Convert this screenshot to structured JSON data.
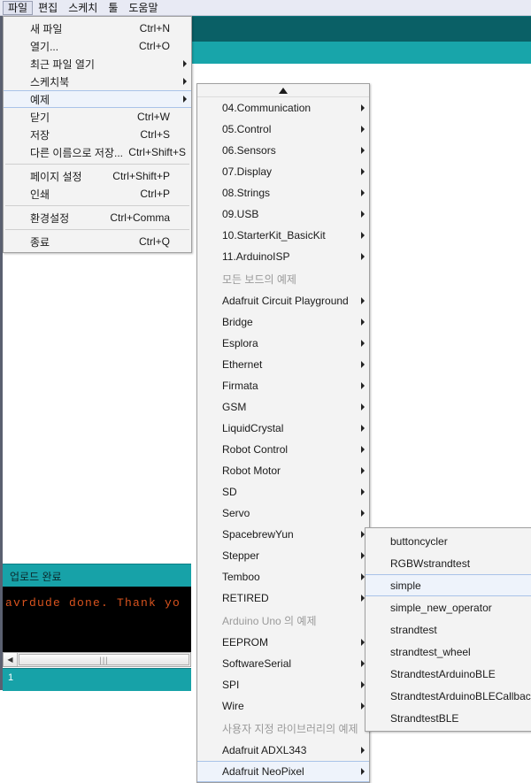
{
  "app": {
    "menubar": [
      {
        "label": "파일",
        "active": true
      },
      {
        "label": "편집",
        "active": false
      },
      {
        "label": "스케치",
        "active": false
      },
      {
        "label": "툴",
        "active": false
      },
      {
        "label": "도움말",
        "active": false
      }
    ]
  },
  "console": {
    "status_label": "업로드 완료",
    "output_line": "avrdude done.  Thank yo",
    "statusbar_text": "1",
    "scrollbar_left_arrow": "◀",
    "scrollbar_grip": "|||"
  },
  "file_menu": {
    "items": [
      {
        "label": "새 파일",
        "accel": "Ctrl+N",
        "submenu": false,
        "selected": false,
        "type": "item"
      },
      {
        "label": "열기...",
        "accel": "Ctrl+O",
        "submenu": false,
        "selected": false,
        "type": "item"
      },
      {
        "label": "최근 파일 열기",
        "accel": "",
        "submenu": true,
        "selected": false,
        "type": "item"
      },
      {
        "label": "스케치북",
        "accel": "",
        "submenu": true,
        "selected": false,
        "type": "item"
      },
      {
        "label": "예제",
        "accel": "",
        "submenu": true,
        "selected": true,
        "type": "item"
      },
      {
        "label": "닫기",
        "accel": "Ctrl+W",
        "submenu": false,
        "selected": false,
        "type": "item"
      },
      {
        "label": "저장",
        "accel": "Ctrl+S",
        "submenu": false,
        "selected": false,
        "type": "item"
      },
      {
        "label": "다른 이름으로 저장...",
        "accel": "Ctrl+Shift+S",
        "submenu": false,
        "selected": false,
        "type": "item",
        "wide": true
      },
      {
        "type": "sep"
      },
      {
        "label": "페이지 설정",
        "accel": "Ctrl+Shift+P",
        "submenu": false,
        "selected": false,
        "type": "item"
      },
      {
        "label": "인쇄",
        "accel": "Ctrl+P",
        "submenu": false,
        "selected": false,
        "type": "item"
      },
      {
        "type": "sep"
      },
      {
        "label": "환경설정",
        "accel": "Ctrl+Comma",
        "submenu": false,
        "selected": false,
        "type": "item"
      },
      {
        "type": "sep"
      },
      {
        "label": "종료",
        "accel": "Ctrl+Q",
        "submenu": false,
        "selected": false,
        "type": "item"
      }
    ]
  },
  "examples_menu": {
    "scroll_up_icon": "scroll-up-triangle",
    "items": [
      {
        "label": "04.Communication",
        "submenu": true,
        "type": "item"
      },
      {
        "label": "05.Control",
        "submenu": true,
        "type": "item"
      },
      {
        "label": "06.Sensors",
        "submenu": true,
        "type": "item"
      },
      {
        "label": "07.Display",
        "submenu": true,
        "type": "item"
      },
      {
        "label": "08.Strings",
        "submenu": true,
        "type": "item"
      },
      {
        "label": "09.USB",
        "submenu": true,
        "type": "item"
      },
      {
        "label": "10.StarterKit_BasicKit",
        "submenu": true,
        "type": "item"
      },
      {
        "label": "11.ArduinoISP",
        "submenu": true,
        "type": "item"
      },
      {
        "label": "모든 보드의 예제",
        "type": "header"
      },
      {
        "label": "Adafruit Circuit Playground",
        "submenu": true,
        "type": "item"
      },
      {
        "label": "Bridge",
        "submenu": true,
        "type": "item"
      },
      {
        "label": "Esplora",
        "submenu": true,
        "type": "item"
      },
      {
        "label": "Ethernet",
        "submenu": true,
        "type": "item"
      },
      {
        "label": "Firmata",
        "submenu": true,
        "type": "item"
      },
      {
        "label": "GSM",
        "submenu": true,
        "type": "item"
      },
      {
        "label": "LiquidCrystal",
        "submenu": true,
        "type": "item"
      },
      {
        "label": "Robot Control",
        "submenu": true,
        "type": "item"
      },
      {
        "label": "Robot Motor",
        "submenu": true,
        "type": "item"
      },
      {
        "label": "SD",
        "submenu": true,
        "type": "item"
      },
      {
        "label": "Servo",
        "submenu": true,
        "type": "item"
      },
      {
        "label": "SpacebrewYun",
        "submenu": true,
        "type": "item"
      },
      {
        "label": "Stepper",
        "submenu": true,
        "type": "item"
      },
      {
        "label": "Temboo",
        "submenu": true,
        "type": "item"
      },
      {
        "label": "RETIRED",
        "submenu": true,
        "type": "item"
      },
      {
        "label": "Arduino Uno 의 예제",
        "type": "header"
      },
      {
        "label": "EEPROM",
        "submenu": true,
        "type": "item"
      },
      {
        "label": "SoftwareSerial",
        "submenu": true,
        "type": "item"
      },
      {
        "label": "SPI",
        "submenu": true,
        "type": "item"
      },
      {
        "label": "Wire",
        "submenu": true,
        "type": "item"
      },
      {
        "label": "사용자 지정 라이브러리의 예제",
        "type": "header"
      },
      {
        "label": "Adafruit ADXL343",
        "submenu": true,
        "type": "item"
      },
      {
        "label": "Adafruit NeoPixel",
        "submenu": true,
        "type": "item",
        "selected": true
      }
    ]
  },
  "neopixel_menu": {
    "items": [
      {
        "label": "buttoncycler",
        "selected": false
      },
      {
        "label": "RGBWstrandtest",
        "selected": false
      },
      {
        "label": "simple",
        "selected": true
      },
      {
        "label": "simple_new_operator",
        "selected": false
      },
      {
        "label": "strandtest",
        "selected": false
      },
      {
        "label": "strandtest_wheel",
        "selected": false
      },
      {
        "label": "StrandtestArduinoBLE",
        "selected": false
      },
      {
        "label": "StrandtestArduinoBLECallback",
        "selected": false
      },
      {
        "label": "StrandtestBLE",
        "selected": false
      }
    ]
  },
  "colors": {
    "toolbar_dark": "#0a6066",
    "toolbar_light": "#18a5aa",
    "console_bg": "#000000",
    "console_text": "#d9531e",
    "highlight": "#eef3fb"
  }
}
